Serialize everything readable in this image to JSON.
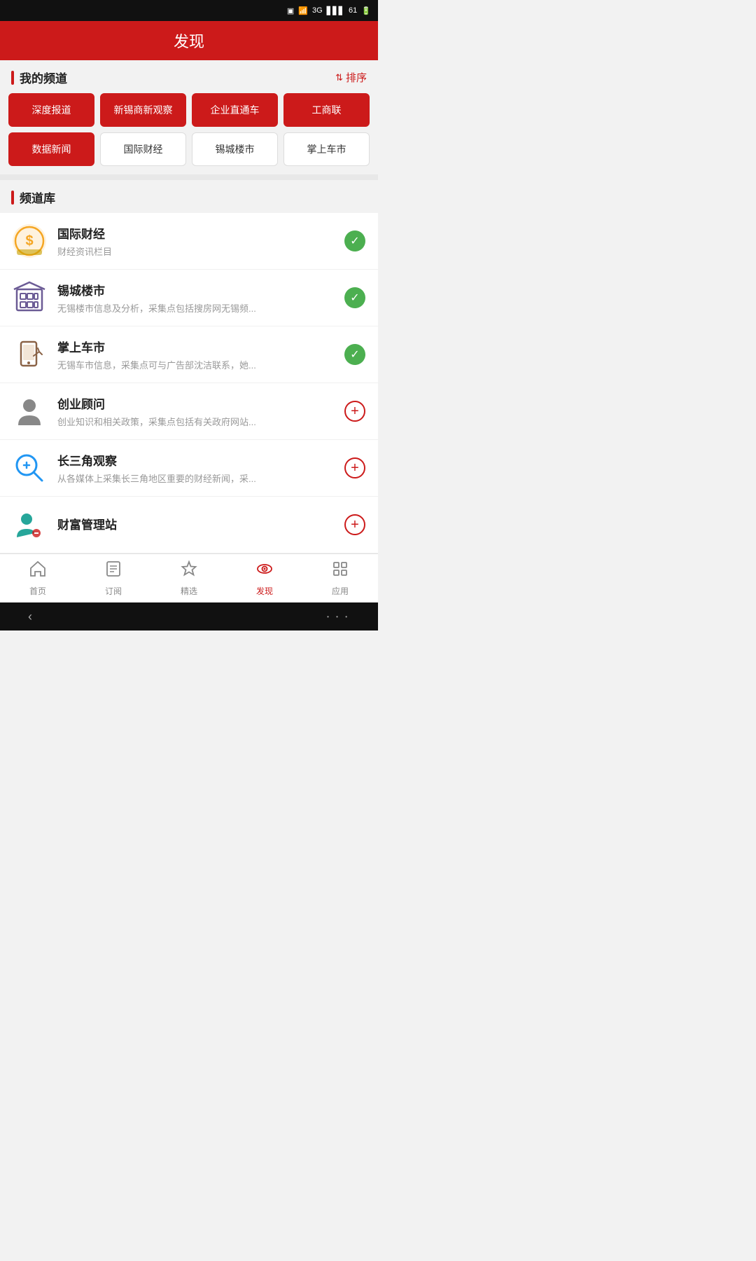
{
  "statusBar": {
    "battery": "61",
    "signal": "3G"
  },
  "header": {
    "title": "发现"
  },
  "myChannels": {
    "sectionTitle": "我的频道",
    "sortLabel": "排序",
    "channels": [
      {
        "label": "深度报道",
        "active": true
      },
      {
        "label": "新锡商新观察",
        "active": true
      },
      {
        "label": "企业直通车",
        "active": true
      },
      {
        "label": "工商联",
        "active": true
      },
      {
        "label": "数据新闻",
        "active": true
      },
      {
        "label": "国际财经",
        "active": false
      },
      {
        "label": "锡城楼市",
        "active": false
      },
      {
        "label": "掌上车市",
        "active": false
      }
    ]
  },
  "channelLibrary": {
    "sectionTitle": "频道库",
    "items": [
      {
        "name": "国际财经",
        "desc": "财经资讯栏目",
        "added": true,
        "iconType": "finance"
      },
      {
        "name": "锡城楼市",
        "desc": "无锡楼市信息及分析，采集点包括搜房网无锡频...",
        "added": true,
        "iconType": "building"
      },
      {
        "name": "掌上车市",
        "desc": "无锡车市信息，采集点可与广告部沈洁联系，她...",
        "added": true,
        "iconType": "car"
      },
      {
        "name": "创业顾问",
        "desc": "创业知识和相关政策，采集点包括有关政府网站...",
        "added": false,
        "iconType": "person"
      },
      {
        "name": "长三角观察",
        "desc": "从各媒体上采集长三角地区重要的财经新闻，采...",
        "added": false,
        "iconType": "searchplus"
      },
      {
        "name": "财富管理站",
        "desc": "",
        "added": false,
        "iconType": "wealth"
      }
    ]
  },
  "bottomNav": {
    "items": [
      {
        "label": "首页",
        "icon": "home",
        "active": false
      },
      {
        "label": "订阅",
        "icon": "book",
        "active": false
      },
      {
        "label": "精选",
        "icon": "star",
        "active": false
      },
      {
        "label": "发现",
        "icon": "eye",
        "active": true
      },
      {
        "label": "应用",
        "icon": "grid",
        "active": false
      }
    ]
  }
}
